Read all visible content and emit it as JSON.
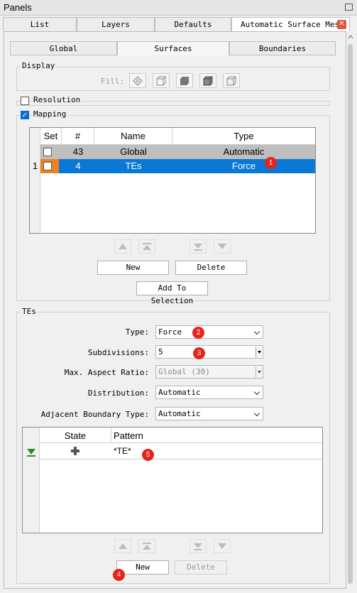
{
  "window": {
    "title": "Panels"
  },
  "tabs": [
    "List",
    "Layers",
    "Defaults",
    "Automatic Surface Mesh"
  ],
  "subtabs": [
    "Global",
    "Surfaces",
    "Boundaries"
  ],
  "display": {
    "label": "Display",
    "fill_label": "Fill:"
  },
  "resolution": {
    "label": "Resolution",
    "checked": false
  },
  "mapping": {
    "label": "Mapping",
    "checked": true,
    "columns": [
      "Set",
      "#",
      "Name",
      "Type"
    ],
    "rows": [
      {
        "row_num": "",
        "number": "43",
        "name": "Global",
        "type": "Automatic"
      },
      {
        "row_num": "1",
        "number": "4",
        "name": "TEs",
        "type": "Force"
      }
    ],
    "new_label": "New",
    "delete_label": "Delete",
    "add_label": "Add To Selection"
  },
  "tes": {
    "label": "TEs",
    "fields": {
      "type_label": "Type:",
      "type_value": "Force",
      "subdivisions_label": "Subdivisions:",
      "subdivisions_value": "5",
      "aspect_label": "Max. Aspect Ratio:",
      "aspect_value": "Global (30)",
      "distribution_label": "Distribution:",
      "distribution_value": "Automatic",
      "adjacent_label": "Adjacent Boundary Type:",
      "adjacent_value": "Automatic"
    },
    "columns": [
      "State",
      "Pattern"
    ],
    "pattern": "*TE*",
    "new_label": "New",
    "delete_label": "Delete"
  },
  "badges": [
    "1",
    "2",
    "3",
    "4",
    "5"
  ],
  "colors": {
    "selection": "#0a78d7",
    "badge": "#e8231b",
    "orange": "#f0821e"
  }
}
